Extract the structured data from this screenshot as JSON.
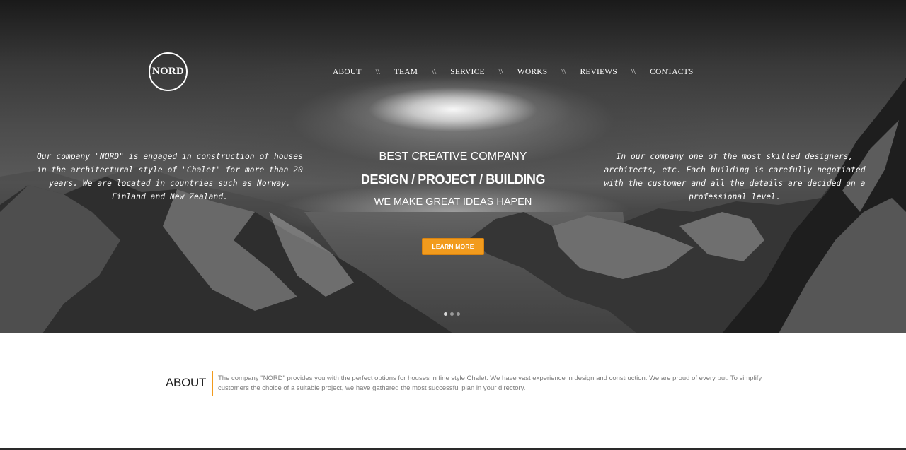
{
  "logo": {
    "text": "NORD"
  },
  "nav": {
    "items": [
      "ABOUT",
      "TEAM",
      "SERVICE",
      "WORKS",
      "REVIEWS",
      "CONTACTS"
    ],
    "separator": "\\\\"
  },
  "hero": {
    "left_text": "Our company \"NORD\" is engaged in construction of houses in the architectural style of \"Chalet\" for more than 20 years. We are located in countries such as Norway, Finland and New Zealand.",
    "right_text": "In our company one of the most skilled designers, architects, etc. Each building is carefully negotiated with the customer and all the details are decided on a professional level.",
    "tagline1": "BEST CREATIVE COMPANY",
    "tagline2": "DESIGN / PROJECT / BUILDING",
    "tagline3": "WE MAKE GREAT IDEAS HAPEN",
    "button_label": "LEARN MORE",
    "slider": {
      "count": 3,
      "active_index": 0
    }
  },
  "about": {
    "title": "ABOUT",
    "text": "The company \"NORD\" provides you with the perfect options for houses in fine style Chalet. We have vast experience in design and construction. We are proud of every put. To simplify customers the choice of a suitable project, we have gathered the most successful plan in your directory."
  },
  "colors": {
    "accent": "#f29b1d",
    "hero_text": "#ffffff",
    "about_text": "#7a7a7a"
  }
}
